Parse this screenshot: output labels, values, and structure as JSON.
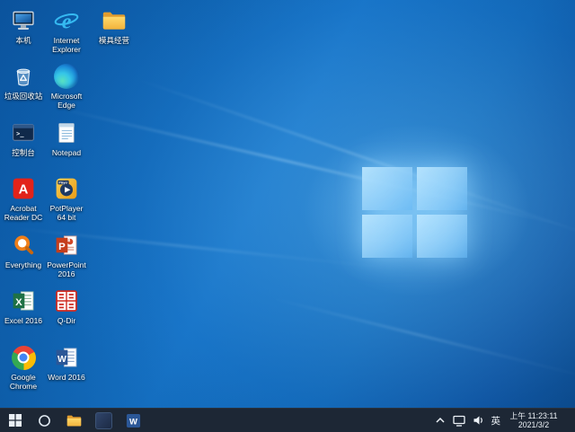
{
  "desktop": {
    "icons": [
      {
        "label": "本机",
        "icon": "this-pc-icon"
      },
      {
        "label": "Internet Explorer",
        "icon": "internet-explorer-icon"
      },
      {
        "label": "模具经营",
        "icon": "folder-icon"
      },
      {
        "label": "垃圾回收站",
        "icon": "recycle-bin-icon"
      },
      {
        "label": "Microsoft Edge",
        "icon": "edge-icon"
      },
      {
        "label": "控制台",
        "icon": "console-icon"
      },
      {
        "label": "Notepad",
        "icon": "notepad-icon"
      },
      {
        "label": "Acrobat Reader DC",
        "icon": "acrobat-reader-icon"
      },
      {
        "label": "PotPlayer 64 bit",
        "icon": "potplayer-icon"
      },
      {
        "label": "Everything",
        "icon": "everything-icon"
      },
      {
        "label": "PowerPoint 2016",
        "icon": "powerpoint-icon"
      },
      {
        "label": "Excel 2016",
        "icon": "excel-icon"
      },
      {
        "label": "Q-Dir",
        "icon": "qdir-icon"
      },
      {
        "label": "Google Chrome",
        "icon": "chrome-icon"
      },
      {
        "label": "Word 2016",
        "icon": "word-icon"
      }
    ]
  },
  "taskbar": {
    "buttons": [
      {
        "name": "start"
      },
      {
        "name": "search"
      },
      {
        "name": "file-explorer"
      },
      {
        "name": "pinned-app"
      },
      {
        "name": "word"
      }
    ],
    "tray": {
      "ime": "英",
      "time": "上午 11:23:11",
      "date": "2021/3/2"
    }
  },
  "colors": {
    "taskbar": "#1d2735",
    "desktop_base": "#0f6cbe",
    "logo_pane": "#8fd0fa"
  }
}
